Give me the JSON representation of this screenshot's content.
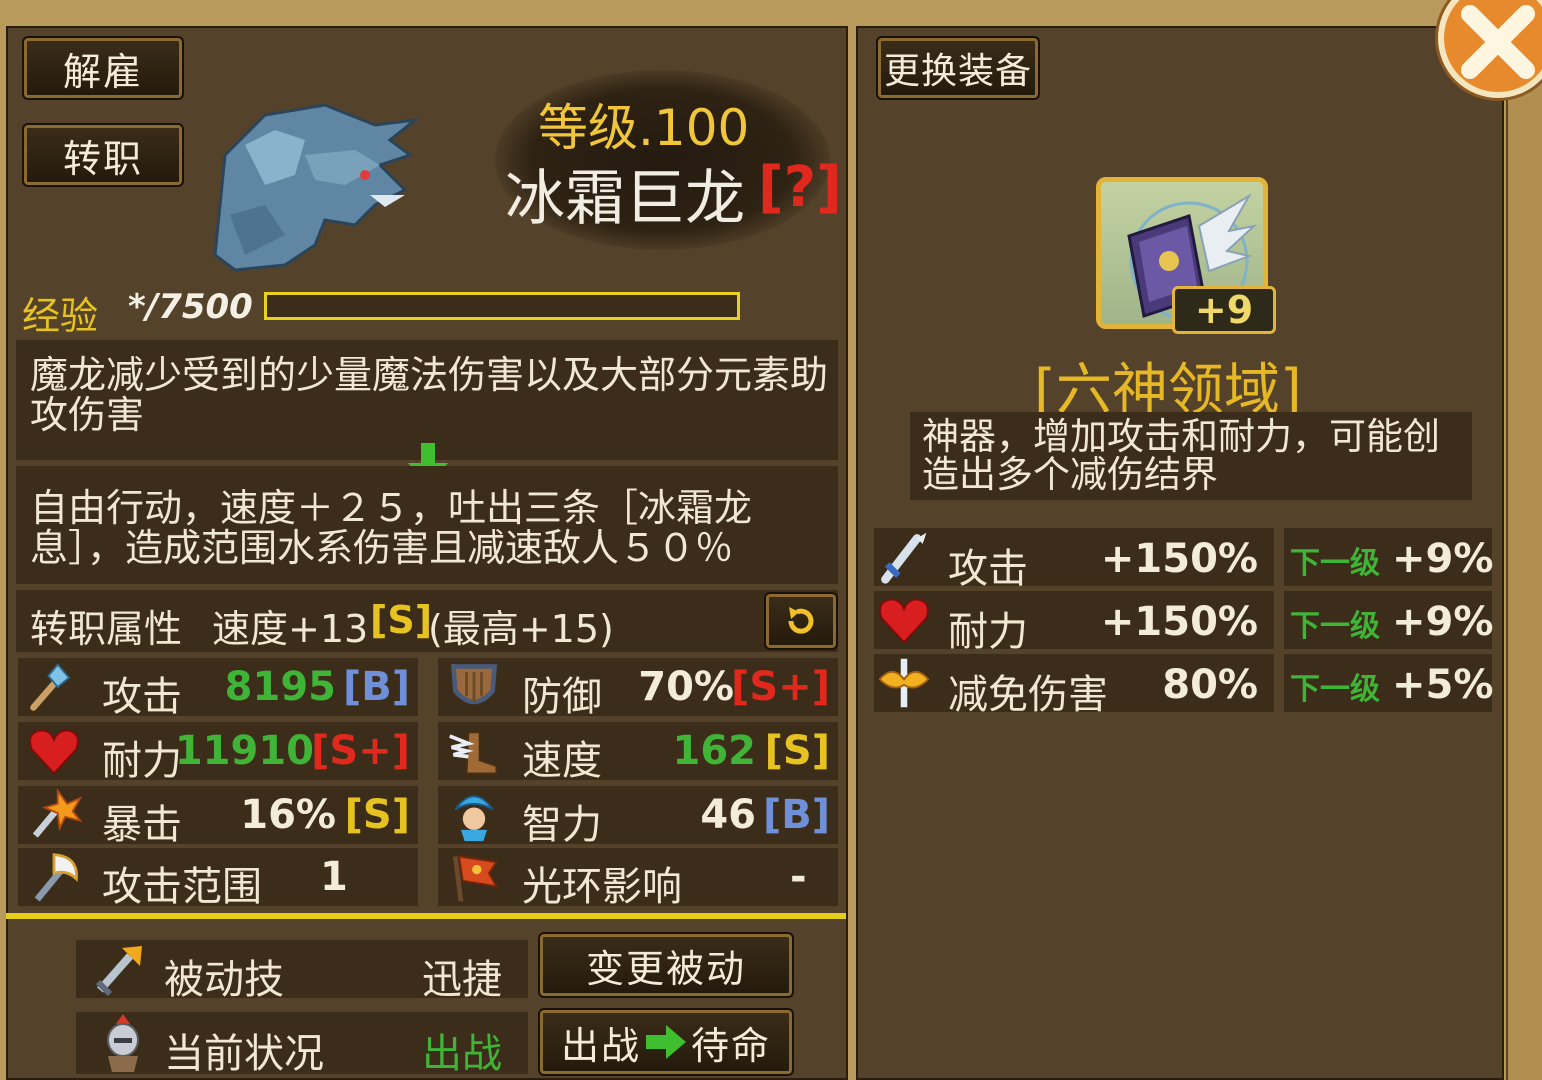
{
  "buttons": {
    "dismiss": "解雇",
    "job_change": "转职",
    "change_equipment": "更换装备",
    "change_passive": "变更被动",
    "status_switch_from": "出战",
    "status_switch_to": "待命"
  },
  "unit": {
    "level": "等级.100",
    "name": "冰霜巨龙",
    "help_tag": "[?]",
    "exp_label": "经验",
    "exp_value": "*/7500",
    "exp_progress": 0
  },
  "descriptions": {
    "passive_desc": "魔龙减少受到的少量魔法伤害以及大部分元素助攻伤害",
    "skill_desc": "自由行动，速度＋２５，吐出三条［冰霜龙息］，造成范围水系伤害且减速敌人５０％"
  },
  "job_attr": {
    "label": "转职属性",
    "text": "速度+13",
    "grade": "[S]",
    "max": "(最高+15)"
  },
  "stats": [
    {
      "label": "攻击",
      "value": "8195",
      "grade": "[B]",
      "icon": "staff-icon"
    },
    {
      "label": "防御",
      "value": "70%",
      "grade": "[S+]",
      "icon": "shield-icon"
    },
    {
      "label": "耐力",
      "value": "11910",
      "grade": "[S+]",
      "icon": "heart-icon"
    },
    {
      "label": "速度",
      "value": "162",
      "grade": "[S]",
      "icon": "winged-boot-icon"
    },
    {
      "label": "暴击",
      "value": "16%",
      "grade": "[S]",
      "icon": "critical-sword-icon"
    },
    {
      "label": "智力",
      "value": "46",
      "grade": "[B]",
      "icon": "wizard-icon"
    },
    {
      "label": "攻击范围",
      "value": "1",
      "icon": "axe-icon"
    },
    {
      "label": "光环影响",
      "value": "-",
      "icon": "flag-icon"
    }
  ],
  "bottom": {
    "passive_label": "被动技",
    "passive_value": "迅捷",
    "status_label": "当前状况",
    "status_value": "出战"
  },
  "equipment": {
    "enhance": "+9",
    "name": "[六神领域]",
    "desc": "神器，增加攻击和耐力，可能创造出多个减伤结界",
    "next_level_label": "下一级",
    "bonuses": [
      {
        "label": "攻击",
        "value": "+150%",
        "next": "+9%",
        "icon": "sword-icon"
      },
      {
        "label": "耐力",
        "value": "+150%",
        "next": "+9%",
        "icon": "heart-icon"
      },
      {
        "label": "减免伤害",
        "value": "80%",
        "next": "+5%",
        "icon": "winged-sword-icon"
      }
    ]
  },
  "colors": {
    "grade_s_plus": "#e0281d",
    "grade_s": "#e6c321",
    "grade_b": "#6f8fd8",
    "value_green": "#3fb436",
    "level_gold": "#f1c63a"
  }
}
